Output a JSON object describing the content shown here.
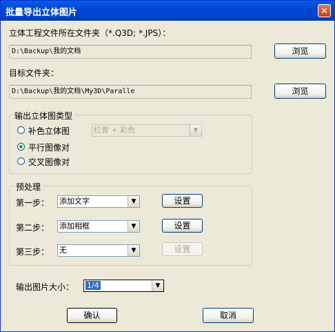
{
  "window": {
    "title": "批量导出立体图片",
    "close": "✕"
  },
  "source": {
    "label": "立体工程文件所在文件夹（*.Q3D; *.JPS）：",
    "path": "D:\\Backup\\我的文档",
    "browse": "浏览"
  },
  "target": {
    "label": "目标文件夹：",
    "path": "D:\\Backup\\我的文档\\My3D\\Paralle",
    "browse": "浏览"
  },
  "output_type": {
    "title": "输出立体图类型",
    "options": [
      {
        "label": "补色立体图",
        "checked": false
      },
      {
        "label": "平行图像对",
        "checked": true
      },
      {
        "label": "交叉图像对",
        "checked": false
      }
    ],
    "anaglyph_combo": "红青 + 彩色"
  },
  "preprocess": {
    "title": "预处理",
    "steps": [
      {
        "label": "第一步：",
        "value": "添加文字",
        "button": "设置",
        "enabled": true
      },
      {
        "label": "第二步：",
        "value": "添加相框",
        "button": "设置",
        "enabled": true
      },
      {
        "label": "第三步：",
        "value": "无",
        "button": "设置",
        "enabled": false
      }
    ]
  },
  "size": {
    "label": "输出图片大小：",
    "value": "1/4"
  },
  "footer": {
    "ok": "确认",
    "cancel": "取消"
  },
  "icons": {
    "dropdown": "▼"
  }
}
